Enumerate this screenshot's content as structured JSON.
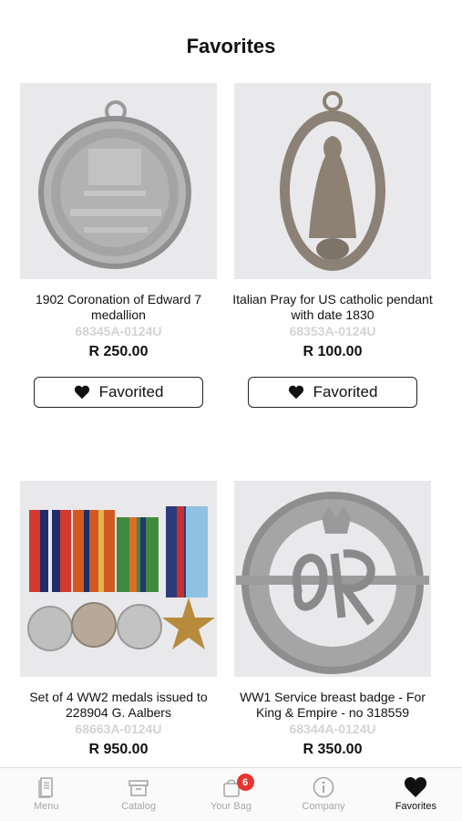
{
  "page": {
    "title": "Favorites"
  },
  "colors": {
    "accent": "#111111",
    "sku_gray": "#d3d3d3",
    "badge_red": "#e5362f",
    "tab_inactive": "#a7a7a7"
  },
  "products": [
    {
      "title": "1902 Coronation of Edward 7 medallion",
      "sku": "68345A-0124U",
      "price": "R 250.00",
      "button_label": "Favorited",
      "image_icon": "coronation-medallion-image"
    },
    {
      "title": "Italian Pray for US catholic pendant with date 1830",
      "sku": "68353A-0124U",
      "price": "R 100.00",
      "button_label": "Favorited",
      "image_icon": "catholic-pendant-image"
    },
    {
      "title": "Set of 4 WW2 medals issued to 228904 G. Aalbers",
      "sku": "68663A-0124U",
      "price": "R 950.00",
      "image_icon": "ww2-medals-image"
    },
    {
      "title": "WW1 Service breast badge - For King & Empire - no 318559",
      "sku": "68344A-0124U",
      "price": "R 350.00",
      "image_icon": "ww1-badge-image"
    }
  ],
  "tabbar": {
    "items": [
      {
        "label": "Menu",
        "icon": "menu-book-icon"
      },
      {
        "label": "Catalog",
        "icon": "catalog-box-icon"
      },
      {
        "label": "Your Bag",
        "icon": "bag-icon",
        "badge": "6"
      },
      {
        "label": "Company",
        "icon": "info-icon"
      },
      {
        "label": "Favorites",
        "icon": "heart-icon",
        "active": true
      }
    ]
  }
}
